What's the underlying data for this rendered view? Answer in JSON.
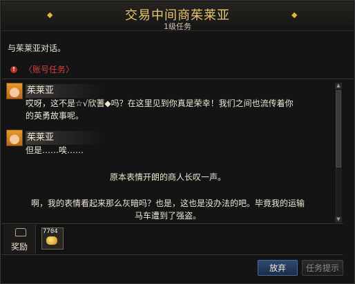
{
  "window": {
    "title": "交易中间商茱莱亚",
    "subtitle": "1级任务",
    "title_ornament": "◆"
  },
  "quest": {
    "objective": "与茱莱亚对话。",
    "type_label": "〈账号任务〉"
  },
  "dialog": {
    "entries": [
      {
        "speaker": "茱莱亚",
        "lines": [
          "哎呀，这不是☆√欣蓍◆吗？在这里见到你真是荣幸！我们之间也流传着你",
          "的英勇故事呢。"
        ]
      },
      {
        "speaker": "茱莱亚",
        "lines": [
          "但是……唉……"
        ]
      }
    ],
    "narration": "原本表情开朗的商人长叹一声。",
    "continuation": [
      "啊，我的表情看起来那么灰暗吗？也是，这也是没办法的吧。毕竟我的运输",
      "马车遭到了强盗。"
    ]
  },
  "rewards": {
    "label": "奖励",
    "items": [
      {
        "icon": "gold-coin-icon",
        "count": "7704"
      }
    ]
  },
  "buttons": {
    "abandon": "放弃",
    "hint": "任务提示"
  },
  "colors": {
    "title_gold": "#e6c66a",
    "account_quest_red": "#d8413a",
    "abandon_button_blue": "#2f4a70"
  }
}
